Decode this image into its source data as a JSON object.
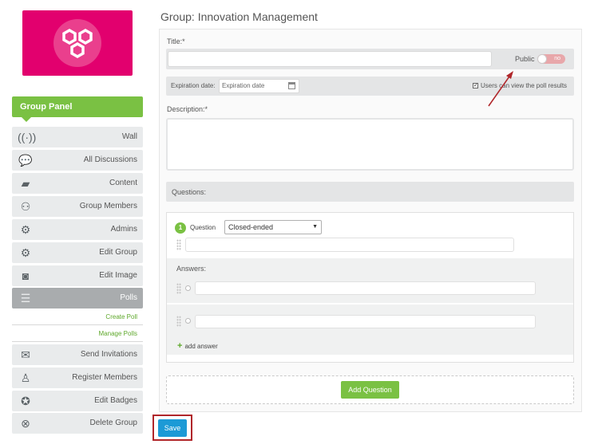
{
  "colors": {
    "brand_green": "#7ac143",
    "logo_pink": "#e2006e",
    "save_blue": "#1c9ad6",
    "annotation_red": "#b0262a"
  },
  "logo": {
    "icon": "hexagons-icon"
  },
  "sidebar": {
    "panel_title": "Group Panel",
    "items": [
      {
        "label": "Wall",
        "icon": "broadcast-icon"
      },
      {
        "label": "All Discussions",
        "icon": "chat-bubbles-icon"
      },
      {
        "label": "Content",
        "icon": "folder-icon"
      },
      {
        "label": "Group Members",
        "icon": "members-icon"
      },
      {
        "label": "Admins",
        "icon": "admins-icon"
      },
      {
        "label": "Edit Group",
        "icon": "gears-icon"
      },
      {
        "label": "Edit Image",
        "icon": "camera-icon"
      },
      {
        "label": "Polls",
        "icon": "bar-chart-icon"
      }
    ],
    "sub_links": [
      "Create Poll",
      "Manage Polls"
    ],
    "items_bottom": [
      {
        "label": "Send Invitations",
        "icon": "envelope-icon"
      },
      {
        "label": "Register Members",
        "icon": "add-user-icon"
      },
      {
        "label": "Edit Badges",
        "icon": "badge-icon"
      },
      {
        "label": "Delete Group",
        "icon": "delete-group-icon"
      }
    ]
  },
  "main": {
    "title": "Group: Innovation Management",
    "title_label": "Title:*",
    "public_label": "Public",
    "public_toggle": "no",
    "expiration_label": "Expiration date:",
    "expiration_placeholder": "Expiration date",
    "results_visible_label": "Users can view the poll results",
    "results_visible_checked": true,
    "description_label": "Description:*",
    "questions_label": "Questions:",
    "question": {
      "number": "1",
      "label": "Question",
      "type_selected": "Closed-ended",
      "answers_label": "Answers:",
      "add_answer": "add answer"
    },
    "add_question": "Add Question",
    "save": "Save"
  }
}
